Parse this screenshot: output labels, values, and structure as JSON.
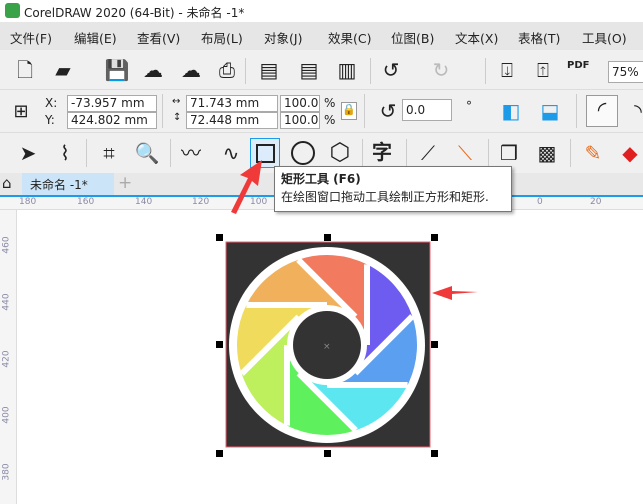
{
  "title": "CorelDRAW 2020 (64-Bit) - 未命名 -1*",
  "menu": [
    "文件(F)",
    "编辑(E)",
    "查看(V)",
    "布局(L)",
    "对象(J)",
    "效果(C)",
    "位图(B)",
    "文本(X)",
    "表格(T)",
    "工具(O)"
  ],
  "toolbar": {
    "zoom": "75%",
    "pdf": "PDF"
  },
  "props": {
    "x_label": "X:",
    "y_label": "Y:",
    "x": "-73.957 mm",
    "y": "424.802 mm",
    "w": "71.743 mm",
    "h": "72.448 mm",
    "sx": "100.0",
    "sy": "100.0",
    "pct": "%",
    "angle": "0.0",
    "deg": "°"
  },
  "tools": {
    "text_tool": "字"
  },
  "doc_tab": "未命名 -1*",
  "tooltip": {
    "title": "矩形工具 (F6)",
    "desc": "在绘图窗口拖动工具绘制正方形和矩形."
  },
  "ruler_top": [
    "180",
    "160",
    "140",
    "120",
    "100",
    "0",
    "20"
  ],
  "ruler_left": [
    "460",
    "440",
    "420",
    "400",
    "380"
  ],
  "colors": {
    "accent": "#1e9be8",
    "arrow": "#f03a3a",
    "rect": "#333333",
    "blades": [
      "#f27a5e",
      "#6e5cf0",
      "#5b9ff0",
      "#5ce6f0",
      "#5ff05e",
      "#bdf05c",
      "#f0db5c",
      "#f0b05c"
    ]
  }
}
